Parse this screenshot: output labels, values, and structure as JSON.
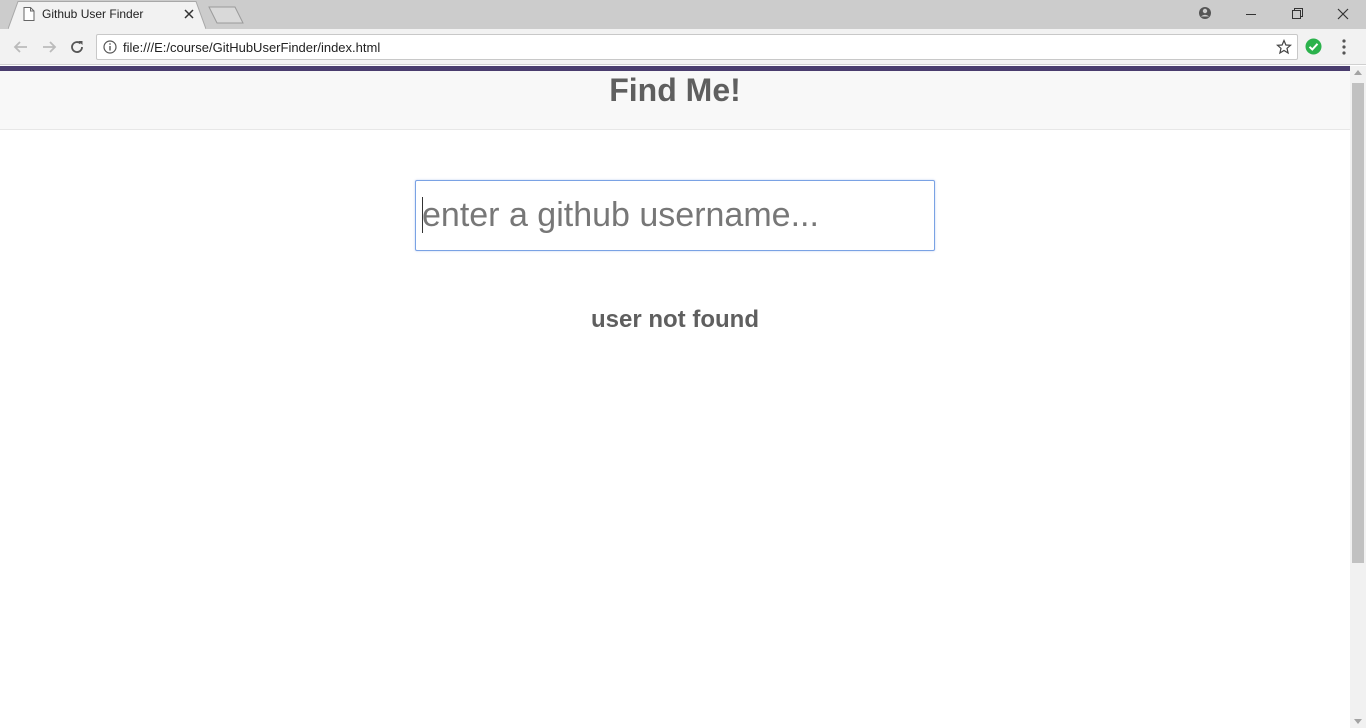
{
  "browser": {
    "tab_title": "Github User Finder",
    "url": "file:///E:/course/GitHubUserFinder/index.html",
    "icons": {
      "tab": "page-icon",
      "close": "close-icon",
      "back": "back-arrow-icon",
      "forward": "forward-arrow-icon",
      "reload": "reload-icon",
      "info": "info-icon",
      "bookmark": "star-icon",
      "extension": "checkmark-extension-icon",
      "menu": "kebab-menu-icon",
      "profile": "profile-icon"
    }
  },
  "page": {
    "title": "Find Me!",
    "search": {
      "placeholder": "enter a github username...",
      "value": ""
    },
    "message": "user not found"
  },
  "colors": {
    "accent_bar": "#4a3d6e",
    "heading_text": "#5f5f5f",
    "input_focus_border": "#7aa2e4",
    "extension_green": "#2bb24c"
  }
}
